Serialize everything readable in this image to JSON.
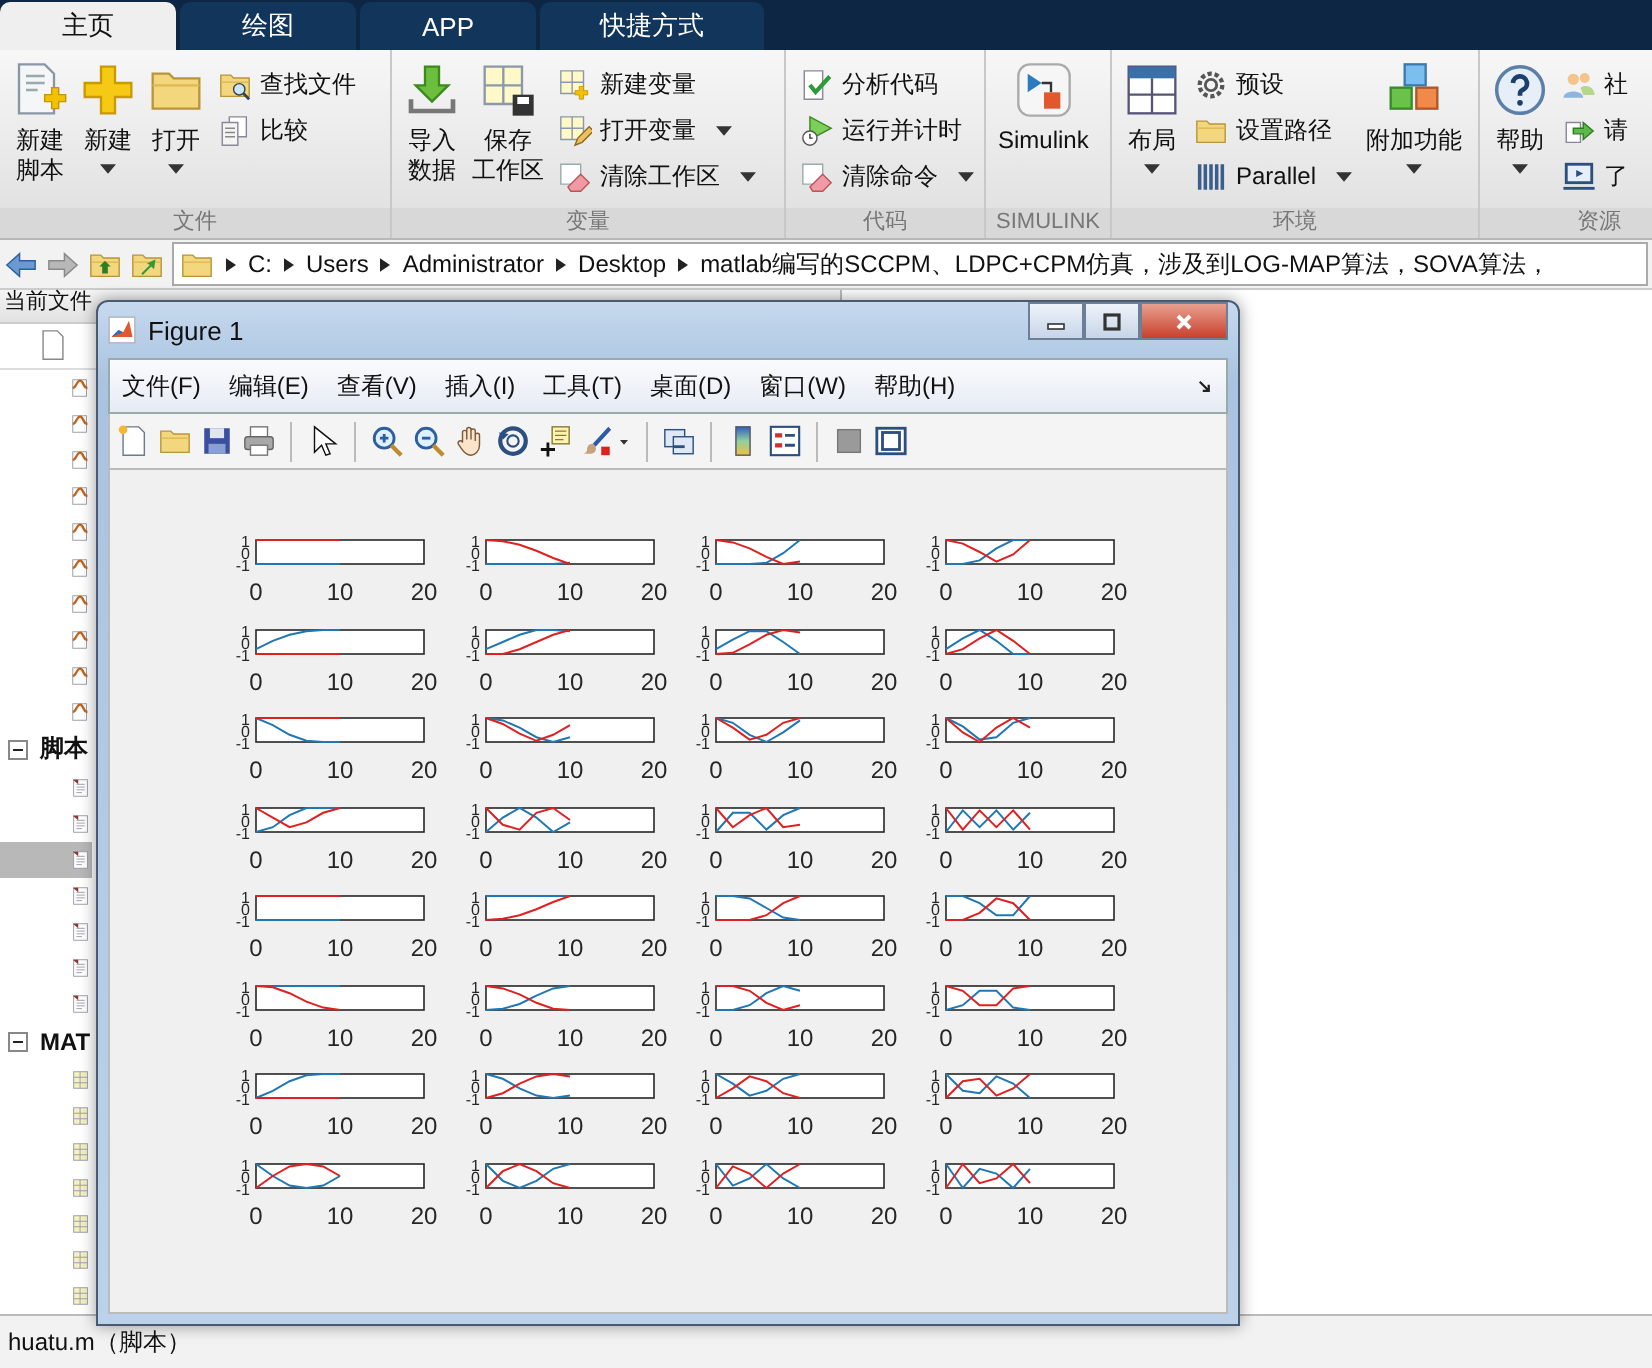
{
  "ribbon_tabs": [
    {
      "label": "主页",
      "selected": true
    },
    {
      "label": "绘图",
      "selected": false
    },
    {
      "label": "APP",
      "selected": false
    },
    {
      "label": "快捷方式",
      "selected": false
    }
  ],
  "ribbon_groups": [
    {
      "title": "文件",
      "items": [
        {
          "kind": "large",
          "lines": [
            "新建",
            "脚本"
          ],
          "menu": false
        },
        {
          "kind": "large",
          "lines": [
            "新建"
          ],
          "menu": true
        },
        {
          "kind": "large",
          "lines": [
            "打开"
          ],
          "menu": true
        },
        {
          "kind": "small",
          "lines": [
            "查找文件"
          ],
          "menu": false
        },
        {
          "kind": "small",
          "lines": [
            "比较"
          ],
          "menu": false
        }
      ]
    },
    {
      "title": "变量",
      "items": [
        {
          "kind": "large",
          "lines": [
            "导入",
            "数据"
          ],
          "menu": false
        },
        {
          "kind": "large",
          "lines": [
            "保存",
            "工作区"
          ],
          "menu": false
        },
        {
          "kind": "small",
          "lines": [
            "新建变量"
          ],
          "menu": false
        },
        {
          "kind": "small",
          "lines": [
            "打开变量"
          ],
          "menu": true
        },
        {
          "kind": "small",
          "lines": [
            "清除工作区"
          ],
          "menu": true
        }
      ]
    },
    {
      "title": "代码",
      "items": [
        {
          "kind": "small",
          "lines": [
            "分析代码"
          ],
          "menu": false
        },
        {
          "kind": "small",
          "lines": [
            "运行并计时"
          ],
          "menu": false
        },
        {
          "kind": "small",
          "lines": [
            "清除命令"
          ],
          "menu": true
        }
      ]
    },
    {
      "title": "SIMULINK",
      "items": [
        {
          "kind": "large",
          "lines": [
            "Simulink"
          ],
          "menu": false
        }
      ]
    },
    {
      "title": "环境",
      "items": [
        {
          "kind": "large",
          "lines": [
            "布局"
          ],
          "menu": true
        },
        {
          "kind": "small",
          "lines": [
            "预设"
          ],
          "menu": false
        },
        {
          "kind": "small",
          "lines": [
            "设置路径"
          ],
          "menu": false
        },
        {
          "kind": "small",
          "lines": [
            "Parallel"
          ],
          "menu": true
        },
        {
          "kind": "large",
          "lines": [
            "附加功能"
          ],
          "menu": true
        }
      ]
    },
    {
      "title": "资源",
      "items": [
        {
          "kind": "large",
          "lines": [
            "帮助"
          ],
          "menu": true
        },
        {
          "kind": "small",
          "lines": [
            "社"
          ],
          "menu": false
        },
        {
          "kind": "small",
          "lines": [
            "请"
          ],
          "menu": false
        },
        {
          "kind": "small",
          "lines": [
            "了"
          ],
          "menu": false
        }
      ]
    }
  ],
  "address_bar": {
    "path": [
      "C:",
      "Users",
      "Administrator",
      "Desktop",
      "matlab编写的SCCPM、LDPC+CPM仿真，涉及到LOG-MAP算法，SOVA算法，"
    ]
  },
  "current_folder": {
    "title": "当前文件",
    "sections": [
      {
        "rows": [
          {
            "selected": false
          },
          {
            "selected": false
          },
          {
            "selected": false
          },
          {
            "selected": false
          },
          {
            "selected": false
          },
          {
            "selected": false
          },
          {
            "selected": false
          },
          {
            "selected": false
          },
          {
            "selected": false
          },
          {
            "selected": false
          }
        ]
      },
      {
        "label": "脚本",
        "expanded": true,
        "rows": [
          {
            "selected": false
          },
          {
            "selected": false
          },
          {
            "selected": true
          },
          {
            "selected": false
          },
          {
            "selected": false
          },
          {
            "selected": false
          },
          {
            "selected": false
          }
        ]
      },
      {
        "label": "MAT",
        "expanded": true,
        "rows": [
          {
            "selected": false
          },
          {
            "selected": false
          },
          {
            "selected": false
          },
          {
            "selected": false
          },
          {
            "selected": false
          },
          {
            "selected": false
          },
          {
            "selected": false
          }
        ]
      }
    ]
  },
  "status_bar": {
    "text": "huatu.m（脚本）"
  },
  "figure": {
    "title": "Figure 1",
    "menu": [
      "文件(F)",
      "编辑(E)",
      "查看(V)",
      "插入(I)",
      "工具(T)",
      "桌面(D)",
      "窗口(W)",
      "帮助(H)"
    ],
    "subplots": [
      {
        "chart_data": {
          "type": "line",
          "x": [
            0,
            2,
            4,
            6,
            8,
            10
          ],
          "xlim": [
            0,
            20
          ],
          "ylim": [
            -1,
            1
          ],
          "xticks": [
            0,
            10,
            20
          ],
          "yticks": [
            -1,
            0,
            1
          ],
          "series": [
            {
              "color": "#1f77b4",
              "values": [
                -1,
                -1,
                -1,
                -1,
                -1,
                -1
              ]
            },
            {
              "color": "#e02020",
              "values": [
                1,
                1,
                1,
                1,
                1,
                1
              ]
            }
          ]
        }
      },
      {
        "chart_data": {
          "type": "line",
          "x": [
            0,
            2,
            4,
            6,
            8,
            10
          ],
          "xlim": [
            0,
            20
          ],
          "ylim": [
            -1,
            1
          ],
          "xticks": [
            0,
            10,
            20
          ],
          "yticks": [
            -1,
            0,
            1
          ],
          "series": [
            {
              "color": "#1f77b4",
              "values": [
                -1,
                -1,
                -1,
                -1,
                -1,
                -0.9
              ]
            },
            {
              "color": "#e02020",
              "values": [
                1,
                0.9,
                0.6,
                0.1,
                -0.5,
                -1
              ]
            }
          ]
        }
      },
      {
        "chart_data": {
          "type": "line",
          "x": [
            0,
            2,
            4,
            6,
            8,
            10
          ],
          "xlim": [
            0,
            20
          ],
          "ylim": [
            -1,
            1
          ],
          "xticks": [
            0,
            10,
            20
          ],
          "yticks": [
            -1,
            0,
            1
          ],
          "series": [
            {
              "color": "#1f77b4",
              "values": [
                -1,
                -1,
                -1,
                -0.9,
                -0.1,
                1
              ]
            },
            {
              "color": "#e02020",
              "values": [
                1,
                0.8,
                0.3,
                -0.4,
                -1,
                -0.8
              ]
            }
          ]
        }
      },
      {
        "chart_data": {
          "type": "line",
          "x": [
            0,
            2,
            4,
            6,
            8,
            10
          ],
          "xlim": [
            0,
            20
          ],
          "ylim": [
            -1,
            1
          ],
          "xticks": [
            0,
            10,
            20
          ],
          "yticks": [
            -1,
            0,
            1
          ],
          "series": [
            {
              "color": "#1f77b4",
              "values": [
                -1,
                -1,
                -0.7,
                0.3,
                1,
                1
              ]
            },
            {
              "color": "#e02020",
              "values": [
                1,
                0.7,
                0,
                -0.8,
                -0.2,
                1
              ]
            }
          ]
        }
      },
      {
        "chart_data": {
          "type": "line",
          "x": [
            0,
            2,
            4,
            6,
            8,
            10
          ],
          "xlim": [
            0,
            20
          ],
          "ylim": [
            -1,
            1
          ],
          "xticks": [
            0,
            10,
            20
          ],
          "yticks": [
            -1,
            0,
            1
          ],
          "series": [
            {
              "color": "#1f77b4",
              "values": [
                -0.6,
                0.1,
                0.6,
                0.9,
                1,
                1
              ]
            },
            {
              "color": "#e02020",
              "values": [
                -1,
                -1,
                -1,
                -1,
                -1,
                -1
              ]
            }
          ]
        }
      },
      {
        "chart_data": {
          "type": "line",
          "x": [
            0,
            2,
            4,
            6,
            8,
            10
          ],
          "xlim": [
            0,
            20
          ],
          "ylim": [
            -1,
            1
          ],
          "xticks": [
            0,
            10,
            20
          ],
          "yticks": [
            -1,
            0,
            1
          ],
          "series": [
            {
              "color": "#1f77b4",
              "values": [
                -0.6,
                0,
                0.6,
                1,
                1,
                0.9
              ]
            },
            {
              "color": "#e02020",
              "values": [
                -1,
                -1,
                -0.6,
                0,
                0.6,
                1
              ]
            }
          ]
        }
      },
      {
        "chart_data": {
          "type": "line",
          "x": [
            0,
            2,
            4,
            6,
            8,
            10
          ],
          "xlim": [
            0,
            20
          ],
          "ylim": [
            -1,
            1
          ],
          "xticks": [
            0,
            10,
            20
          ],
          "yticks": [
            -1,
            0,
            1
          ],
          "series": [
            {
              "color": "#1f77b4",
              "values": [
                -0.6,
                0.2,
                0.9,
                0.9,
                0,
                -1
              ]
            },
            {
              "color": "#e02020",
              "values": [
                -1,
                -0.9,
                -0.2,
                0.6,
                1,
                0.8
              ]
            }
          ]
        }
      },
      {
        "chart_data": {
          "type": "line",
          "x": [
            0,
            2,
            4,
            6,
            8,
            10
          ],
          "xlim": [
            0,
            20
          ],
          "ylim": [
            -1,
            1
          ],
          "xticks": [
            0,
            10,
            20
          ],
          "yticks": [
            -1,
            0,
            1
          ],
          "series": [
            {
              "color": "#1f77b4",
              "values": [
                -0.6,
                0.3,
                1,
                0.1,
                -1,
                -1
              ]
            },
            {
              "color": "#e02020",
              "values": [
                -1,
                -0.6,
                0.3,
                1,
                0.1,
                -1
              ]
            }
          ]
        }
      },
      {
        "chart_data": {
          "type": "line",
          "x": [
            0,
            2,
            4,
            6,
            8,
            10
          ],
          "xlim": [
            0,
            20
          ],
          "ylim": [
            -1,
            1
          ],
          "xticks": [
            0,
            10,
            20
          ],
          "yticks": [
            -1,
            0,
            1
          ],
          "series": [
            {
              "color": "#1f77b4",
              "values": [
                1,
                0.4,
                -0.4,
                -0.9,
                -1,
                -1
              ]
            },
            {
              "color": "#e02020",
              "values": [
                1,
                1,
                1,
                1,
                1,
                1
              ]
            }
          ]
        }
      },
      {
        "chart_data": {
          "type": "line",
          "x": [
            0,
            2,
            4,
            6,
            8,
            10
          ],
          "xlim": [
            0,
            20
          ],
          "ylim": [
            -1,
            1
          ],
          "xticks": [
            0,
            10,
            20
          ],
          "yticks": [
            -1,
            0,
            1
          ],
          "series": [
            {
              "color": "#1f77b4",
              "values": [
                1,
                0.8,
                0.2,
                -0.6,
                -1,
                -0.6
              ]
            },
            {
              "color": "#e02020",
              "values": [
                1,
                0.5,
                -0.3,
                -0.9,
                -0.4,
                0.4
              ]
            }
          ]
        }
      },
      {
        "chart_data": {
          "type": "line",
          "x": [
            0,
            2,
            4,
            6,
            8,
            10
          ],
          "xlim": [
            0,
            20
          ],
          "ylim": [
            -1,
            1
          ],
          "xticks": [
            0,
            10,
            20
          ],
          "yticks": [
            -1,
            0,
            1
          ],
          "series": [
            {
              "color": "#1f77b4",
              "values": [
                1,
                0.6,
                -0.4,
                -1,
                -0.2,
                0.8
              ]
            },
            {
              "color": "#e02020",
              "values": [
                1,
                0.2,
                -0.8,
                -0.4,
                0.6,
                1
              ]
            }
          ]
        }
      },
      {
        "chart_data": {
          "type": "line",
          "x": [
            0,
            2,
            4,
            6,
            8,
            10
          ],
          "xlim": [
            0,
            20
          ],
          "ylim": [
            -1,
            1
          ],
          "xticks": [
            0,
            10,
            20
          ],
          "yticks": [
            -1,
            0,
            1
          ],
          "series": [
            {
              "color": "#1f77b4",
              "values": [
                1,
                0.3,
                -0.8,
                -0.6,
                0.6,
                1
              ]
            },
            {
              "color": "#e02020",
              "values": [
                1,
                -0.2,
                -1,
                0.2,
                1,
                0.2
              ]
            }
          ]
        }
      },
      {
        "chart_data": {
          "type": "line",
          "x": [
            0,
            2,
            4,
            6,
            8,
            10
          ],
          "xlim": [
            0,
            20
          ],
          "ylim": [
            -1,
            1
          ],
          "xticks": [
            0,
            10,
            20
          ],
          "yticks": [
            -1,
            0,
            1
          ],
          "series": [
            {
              "color": "#1f77b4",
              "values": [
                -1,
                -0.6,
                0.4,
                1,
                1,
                1
              ]
            },
            {
              "color": "#e02020",
              "values": [
                1,
                0.2,
                -0.6,
                -0.2,
                0.6,
                1
              ]
            }
          ]
        }
      },
      {
        "chart_data": {
          "type": "line",
          "x": [
            0,
            2,
            4,
            6,
            8,
            10
          ],
          "xlim": [
            0,
            20
          ],
          "ylim": [
            -1,
            1
          ],
          "xticks": [
            0,
            10,
            20
          ],
          "yticks": [
            -1,
            0,
            1
          ],
          "series": [
            {
              "color": "#1f77b4",
              "values": [
                -1,
                0.2,
                1,
                0.2,
                -1,
                -0.2
              ]
            },
            {
              "color": "#e02020",
              "values": [
                1,
                -0.4,
                -0.8,
                0.6,
                1,
                0
              ]
            }
          ]
        }
      },
      {
        "chart_data": {
          "type": "line",
          "x": [
            0,
            2,
            4,
            6,
            8,
            10
          ],
          "xlim": [
            0,
            20
          ],
          "ylim": [
            -1,
            1
          ],
          "xticks": [
            0,
            10,
            20
          ],
          "yticks": [
            -1,
            0,
            1
          ],
          "series": [
            {
              "color": "#1f77b4",
              "values": [
                -1,
                0.6,
                0.6,
                -0.8,
                0.4,
                1
              ]
            },
            {
              "color": "#e02020",
              "values": [
                1,
                -0.6,
                0.4,
                1,
                -0.6,
                -0.4
              ]
            }
          ]
        }
      },
      {
        "chart_data": {
          "type": "line",
          "x": [
            0,
            2,
            4,
            6,
            8,
            10
          ],
          "xlim": [
            0,
            20
          ],
          "ylim": [
            -1,
            1
          ],
          "xticks": [
            0,
            10,
            20
          ],
          "yticks": [
            -1,
            0,
            1
          ],
          "series": [
            {
              "color": "#1f77b4",
              "values": [
                -1,
                0.8,
                -0.6,
                0.8,
                -0.8,
                0.6
              ]
            },
            {
              "color": "#e02020",
              "values": [
                1,
                -0.8,
                0.8,
                -0.6,
                0.8,
                -0.8
              ]
            }
          ]
        }
      },
      {
        "chart_data": {
          "type": "line",
          "x": [
            0,
            2,
            4,
            6,
            8,
            10
          ],
          "xlim": [
            0,
            20
          ],
          "ylim": [
            -1,
            1
          ],
          "xticks": [
            0,
            10,
            20
          ],
          "yticks": [
            -1,
            0,
            1
          ],
          "series": [
            {
              "color": "#1f77b4",
              "values": [
                -1,
                -1,
                -1,
                -1,
                -1,
                -1
              ]
            },
            {
              "color": "#e02020",
              "values": [
                1,
                1,
                1,
                1,
                1,
                1
              ]
            }
          ]
        }
      },
      {
        "chart_data": {
          "type": "line",
          "x": [
            0,
            2,
            4,
            6,
            8,
            10
          ],
          "xlim": [
            0,
            20
          ],
          "ylim": [
            -1,
            1
          ],
          "xticks": [
            0,
            10,
            20
          ],
          "yticks": [
            -1,
            0,
            1
          ],
          "series": [
            {
              "color": "#1f77b4",
              "values": [
                1,
                1,
                1,
                1,
                1,
                1
              ]
            },
            {
              "color": "#e02020",
              "values": [
                -1,
                -0.9,
                -0.6,
                -0.1,
                0.5,
                1
              ]
            }
          ]
        }
      },
      {
        "chart_data": {
          "type": "line",
          "x": [
            0,
            2,
            4,
            6,
            8,
            10
          ],
          "xlim": [
            0,
            20
          ],
          "ylim": [
            -1,
            1
          ],
          "xticks": [
            0,
            10,
            20
          ],
          "yticks": [
            -1,
            0,
            1
          ],
          "series": [
            {
              "color": "#1f77b4",
              "values": [
                1,
                1,
                0.8,
                0,
                -0.8,
                -1
              ]
            },
            {
              "color": "#e02020",
              "values": [
                -1,
                -1,
                -1,
                -0.6,
                0.4,
                1
              ]
            }
          ]
        }
      },
      {
        "chart_data": {
          "type": "line",
          "x": [
            0,
            2,
            4,
            6,
            8,
            10
          ],
          "xlim": [
            0,
            20
          ],
          "ylim": [
            -1,
            1
          ],
          "xticks": [
            0,
            10,
            20
          ],
          "yticks": [
            -1,
            0,
            1
          ],
          "series": [
            {
              "color": "#1f77b4",
              "values": [
                1,
                1,
                0.4,
                -0.6,
                -0.6,
                1
              ]
            },
            {
              "color": "#e02020",
              "values": [
                -1,
                -1,
                -0.4,
                0.8,
                0.4,
                -1
              ]
            }
          ]
        }
      },
      {
        "chart_data": {
          "type": "line",
          "x": [
            0,
            2,
            4,
            6,
            8,
            10
          ],
          "xlim": [
            0,
            20
          ],
          "ylim": [
            -1,
            1
          ],
          "xticks": [
            0,
            10,
            20
          ],
          "yticks": [
            -1,
            0,
            1
          ],
          "series": [
            {
              "color": "#1f77b4",
              "values": [
                1,
                1,
                1,
                1,
                1,
                1
              ]
            },
            {
              "color": "#e02020",
              "values": [
                1,
                0.9,
                0.4,
                -0.3,
                -0.8,
                -1
              ]
            }
          ]
        }
      },
      {
        "chart_data": {
          "type": "line",
          "x": [
            0,
            2,
            4,
            6,
            8,
            10
          ],
          "xlim": [
            0,
            20
          ],
          "ylim": [
            -1,
            1
          ],
          "xticks": [
            0,
            10,
            20
          ],
          "yticks": [
            -1,
            0,
            1
          ],
          "series": [
            {
              "color": "#1f77b4",
              "values": [
                -1,
                -0.9,
                -0.5,
                0.2,
                0.8,
                1
              ]
            },
            {
              "color": "#e02020",
              "values": [
                1,
                0.8,
                0.3,
                -0.4,
                -0.9,
                -1
              ]
            }
          ]
        }
      },
      {
        "chart_data": {
          "type": "line",
          "x": [
            0,
            2,
            4,
            6,
            8,
            10
          ],
          "xlim": [
            0,
            20
          ],
          "ylim": [
            -1,
            1
          ],
          "xticks": [
            0,
            10,
            20
          ],
          "yticks": [
            -1,
            0,
            1
          ],
          "series": [
            {
              "color": "#1f77b4",
              "values": [
                -1,
                -1,
                -0.6,
                0.4,
                1,
                0.6
              ]
            },
            {
              "color": "#e02020",
              "values": [
                1,
                1,
                0.6,
                -0.4,
                -1,
                -0.6
              ]
            }
          ]
        }
      },
      {
        "chart_data": {
          "type": "line",
          "x": [
            0,
            2,
            4,
            6,
            8,
            10
          ],
          "xlim": [
            0,
            20
          ],
          "ylim": [
            -1,
            1
          ],
          "xticks": [
            0,
            10,
            20
          ],
          "yticks": [
            -1,
            0,
            1
          ],
          "series": [
            {
              "color": "#1f77b4",
              "values": [
                -1,
                -0.6,
                0.6,
                0.6,
                -0.8,
                -1
              ]
            },
            {
              "color": "#e02020",
              "values": [
                1,
                0.6,
                -0.6,
                -0.6,
                0.8,
                1
              ]
            }
          ]
        }
      },
      {
        "chart_data": {
          "type": "line",
          "x": [
            0,
            2,
            4,
            6,
            8,
            10
          ],
          "xlim": [
            0,
            20
          ],
          "ylim": [
            -1,
            1
          ],
          "xticks": [
            0,
            10,
            20
          ],
          "yticks": [
            -1,
            0,
            1
          ],
          "series": [
            {
              "color": "#1f77b4",
              "values": [
                -1,
                -0.4,
                0.4,
                0.9,
                1,
                1
              ]
            },
            {
              "color": "#e02020",
              "values": [
                -1,
                -1,
                -1,
                -1,
                -1,
                -1
              ]
            }
          ]
        }
      },
      {
        "chart_data": {
          "type": "line",
          "x": [
            0,
            2,
            4,
            6,
            8,
            10
          ],
          "xlim": [
            0,
            20
          ],
          "ylim": [
            -1,
            1
          ],
          "xticks": [
            0,
            10,
            20
          ],
          "yticks": [
            -1,
            0,
            1
          ],
          "series": [
            {
              "color": "#1f77b4",
              "values": [
                1,
                0.6,
                -0.2,
                -0.8,
                -1,
                -0.8
              ]
            },
            {
              "color": "#e02020",
              "values": [
                -1,
                -0.6,
                0.2,
                0.8,
                1,
                0.8
              ]
            }
          ]
        }
      },
      {
        "chart_data": {
          "type": "line",
          "x": [
            0,
            2,
            4,
            6,
            8,
            10
          ],
          "xlim": [
            0,
            20
          ],
          "ylim": [
            -1,
            1
          ],
          "xticks": [
            0,
            10,
            20
          ],
          "yticks": [
            -1,
            0,
            1
          ],
          "series": [
            {
              "color": "#1f77b4",
              "values": [
                1,
                0.2,
                -0.8,
                -0.4,
                0.6,
                1
              ]
            },
            {
              "color": "#e02020",
              "values": [
                -1,
                -0.2,
                0.8,
                0.4,
                -0.6,
                -1
              ]
            }
          ]
        }
      },
      {
        "chart_data": {
          "type": "line",
          "x": [
            0,
            2,
            4,
            6,
            8,
            10
          ],
          "xlim": [
            0,
            20
          ],
          "ylim": [
            -1,
            1
          ],
          "xticks": [
            0,
            10,
            20
          ],
          "yticks": [
            -1,
            0,
            1
          ],
          "series": [
            {
              "color": "#1f77b4",
              "values": [
                1,
                -0.4,
                -0.6,
                0.8,
                0.2,
                -1
              ]
            },
            {
              "color": "#e02020",
              "values": [
                -1,
                0.4,
                0.6,
                -0.8,
                -0.2,
                1
              ]
            }
          ]
        }
      },
      {
        "chart_data": {
          "type": "line",
          "x": [
            0,
            2,
            4,
            6,
            8,
            10
          ],
          "xlim": [
            0,
            20
          ],
          "ylim": [
            -1,
            1
          ],
          "xticks": [
            0,
            10,
            20
          ],
          "yticks": [
            -1,
            0,
            1
          ],
          "series": [
            {
              "color": "#1f77b4",
              "values": [
                1,
                0,
                -0.8,
                -1,
                -0.8,
                0
              ]
            },
            {
              "color": "#e02020",
              "values": [
                -1,
                0,
                0.8,
                1,
                0.8,
                0
              ]
            }
          ]
        }
      },
      {
        "chart_data": {
          "type": "line",
          "x": [
            0,
            2,
            4,
            6,
            8,
            10
          ],
          "xlim": [
            0,
            20
          ],
          "ylim": [
            -1,
            1
          ],
          "xticks": [
            0,
            10,
            20
          ],
          "yticks": [
            -1,
            0,
            1
          ],
          "series": [
            {
              "color": "#1f77b4",
              "values": [
                1,
                -0.4,
                -1,
                -0.4,
                0.6,
                1
              ]
            },
            {
              "color": "#e02020",
              "values": [
                -1,
                0.4,
                1,
                0.4,
                -0.6,
                -1
              ]
            }
          ]
        }
      },
      {
        "chart_data": {
          "type": "line",
          "x": [
            0,
            2,
            4,
            6,
            8,
            10
          ],
          "xlim": [
            0,
            20
          ],
          "ylim": [
            -1,
            1
          ],
          "xticks": [
            0,
            10,
            20
          ],
          "yticks": [
            -1,
            0,
            1
          ],
          "series": [
            {
              "color": "#1f77b4",
              "values": [
                1,
                -0.8,
                -0.2,
                1,
                -0.2,
                -1
              ]
            },
            {
              "color": "#e02020",
              "values": [
                -1,
                0.8,
                0.2,
                -1,
                0.2,
                1
              ]
            }
          ]
        }
      },
      {
        "chart_data": {
          "type": "line",
          "x": [
            0,
            2,
            4,
            6,
            8,
            10
          ],
          "xlim": [
            0,
            20
          ],
          "ylim": [
            -1,
            1
          ],
          "xticks": [
            0,
            10,
            20
          ],
          "yticks": [
            -1,
            0,
            1
          ],
          "series": [
            {
              "color": "#1f77b4",
              "values": [
                1,
                -1,
                0.6,
                0.2,
                -1,
                0.6
              ]
            },
            {
              "color": "#e02020",
              "values": [
                -1,
                1,
                -0.6,
                -0.2,
                1,
                -0.6
              ]
            }
          ]
        }
      }
    ]
  }
}
